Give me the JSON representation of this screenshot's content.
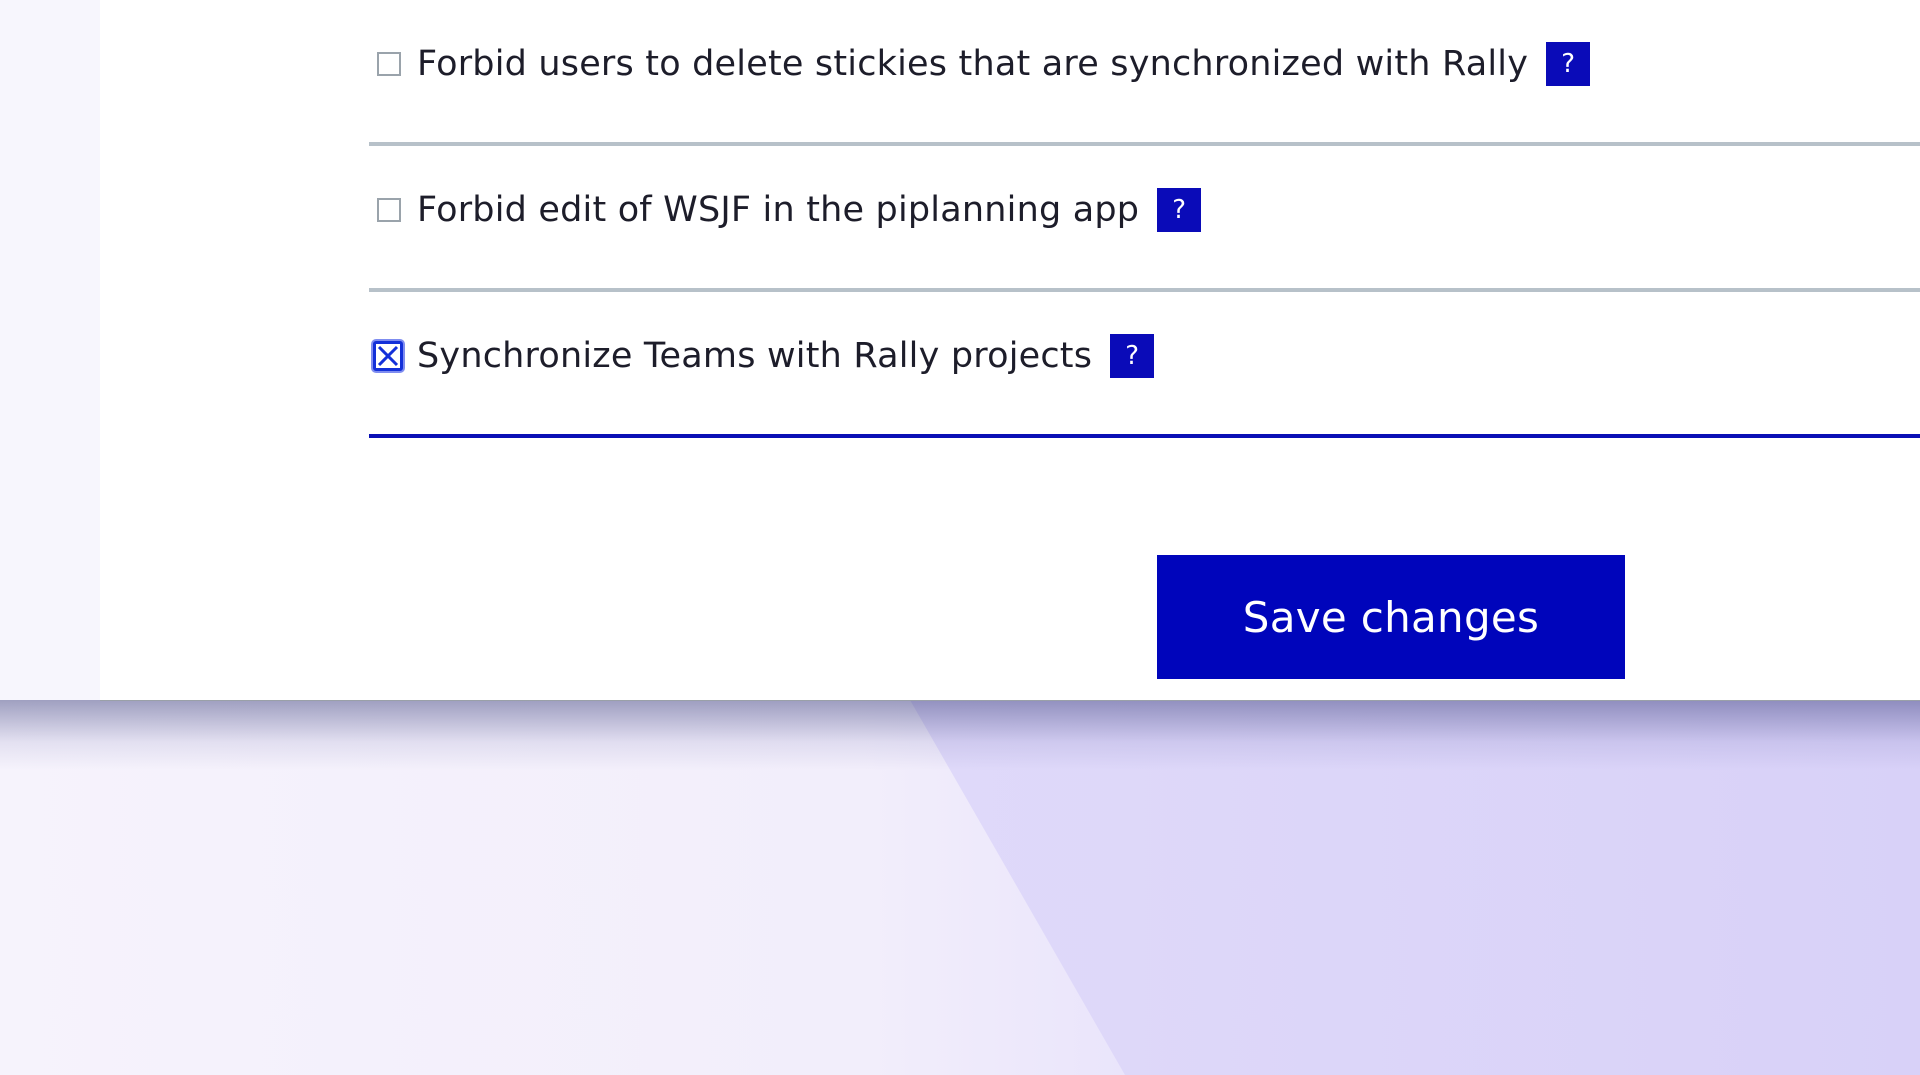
{
  "settings": [
    {
      "label": "Forbid users to delete stickies that are synchronized with Rally",
      "checked": false,
      "help": "?"
    },
    {
      "label": "Forbid edit of WSJF in the piplanning app",
      "checked": false,
      "help": "?"
    },
    {
      "label": "Synchronize Teams with Rally projects",
      "checked": true,
      "help": "?"
    }
  ],
  "save_button": {
    "label": "Save changes"
  },
  "colors": {
    "accent": "#0005bb",
    "divider": "#b7c1c9",
    "active_divider": "#0a10b5"
  }
}
